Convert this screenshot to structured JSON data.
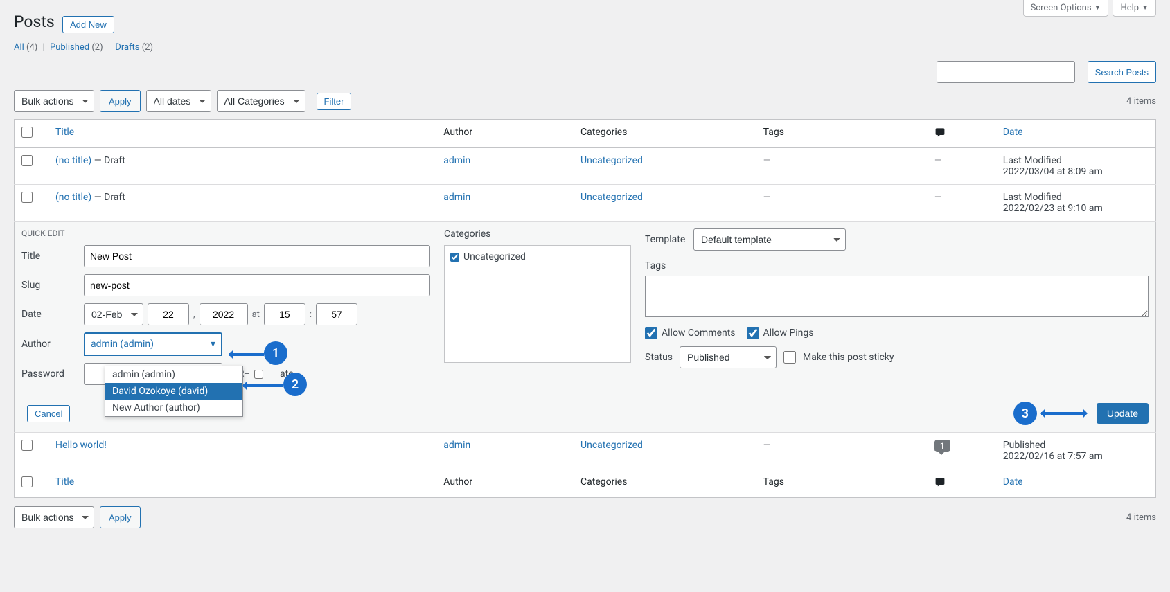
{
  "top_tabs": {
    "screen_options": "Screen Options",
    "help": "Help"
  },
  "page_title": "Posts",
  "add_new": "Add New",
  "filters": {
    "all": "All",
    "all_count": "(4)",
    "published": "Published",
    "published_count": "(2)",
    "drafts": "Drafts",
    "drafts_count": "(2)"
  },
  "search": {
    "button": "Search Posts"
  },
  "bulk": {
    "label": "Bulk actions",
    "apply": "Apply"
  },
  "date_filter": "All dates",
  "cat_filter": "All Categories",
  "filter_btn": "Filter",
  "items_count": "4 items",
  "columns": {
    "title": "Title",
    "author": "Author",
    "categories": "Categories",
    "tags": "Tags",
    "date": "Date"
  },
  "rows": [
    {
      "title": "(no title)",
      "status": " — Draft",
      "author": "admin",
      "category": "Uncategorized",
      "tags": "—",
      "comments": "—",
      "date_label": "Last Modified",
      "date": "2022/03/04 at 8:09 am"
    },
    {
      "title": "(no title)",
      "status": " — Draft",
      "author": "admin",
      "category": "Uncategorized",
      "tags": "—",
      "comments": "—",
      "date_label": "Last Modified",
      "date": "2022/02/23 at 9:10 am"
    }
  ],
  "row_hello": {
    "title": "Hello world!",
    "author": "admin",
    "category": "Uncategorized",
    "tags": "—",
    "comments": "1",
    "date_label": "Published",
    "date": "2022/02/16 at 7:57 am"
  },
  "quick_edit": {
    "heading": "QUICK EDIT",
    "title_label": "Title",
    "title_value": "New Post",
    "slug_label": "Slug",
    "slug_value": "new-post",
    "date_label": "Date",
    "month": "02-Feb",
    "day": "22",
    "year": "2022",
    "at": "at",
    "hour": "15",
    "minute": "57",
    "author_label": "Author",
    "author_value": "admin (admin)",
    "author_options": [
      "admin (admin)",
      "David Ozokoye (david)",
      "New Author (author)"
    ],
    "password_label": "Password",
    "or": "–OR–",
    "private_suffix": "ate",
    "categories_label": "Categories",
    "cat_uncategorized": "Uncategorized",
    "template_label": "Template",
    "template_value": "Default template",
    "tags_label": "Tags",
    "allow_comments": "Allow Comments",
    "allow_pings": "Allow Pings",
    "status_label": "Status",
    "status_value": "Published",
    "sticky": "Make this post sticky",
    "cancel": "Cancel",
    "update": "Update"
  },
  "annotations": {
    "one": "1",
    "two": "2",
    "three": "3"
  }
}
